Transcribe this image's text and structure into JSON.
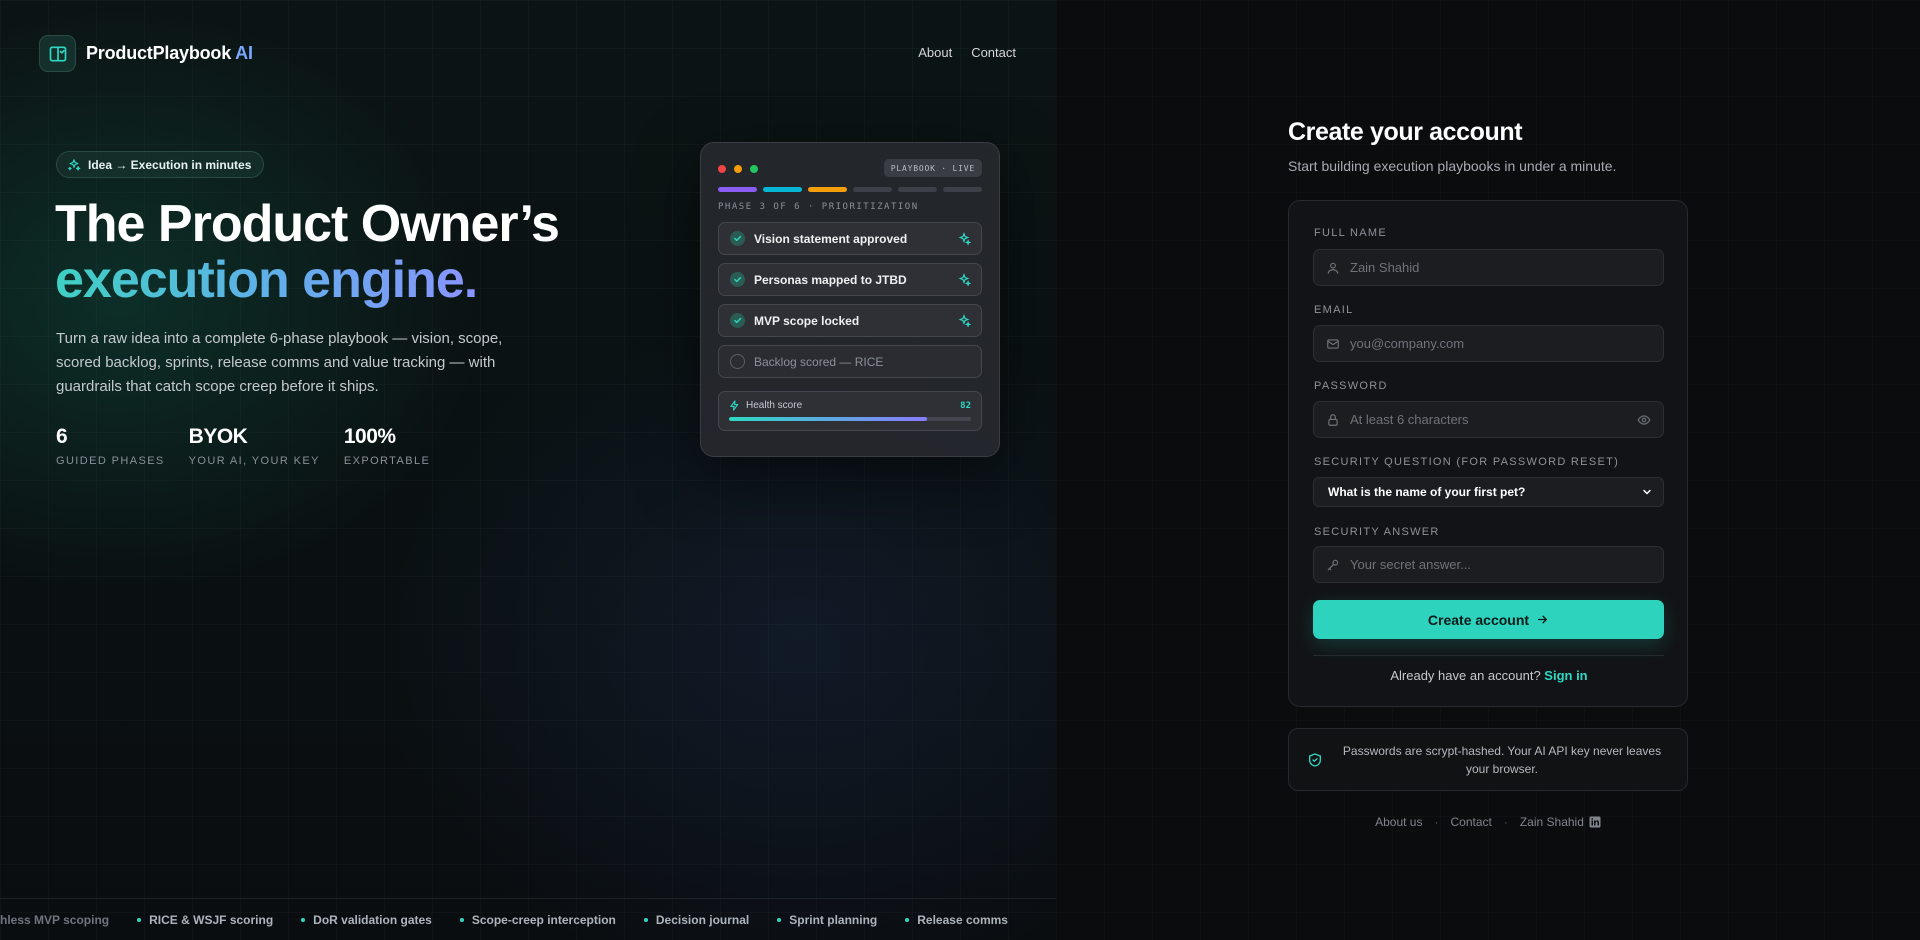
{
  "brand": {
    "name": "ProductPlaybook",
    "suffix": "AI"
  },
  "nav": {
    "about": "About",
    "contact": "Contact"
  },
  "hero": {
    "pill": "Idea → Execution in minutes",
    "title_line1": "The Product Owner’s",
    "title_line2": "execution engine.",
    "description": "Turn a raw idea into a complete 6-phase playbook — vision, scope, scored backlog, sprints, release comms and value tracking — with guardrails that catch scope creep before it ships.",
    "stats": [
      {
        "value": "6",
        "label": "GUIDED PHASES"
      },
      {
        "value": "BYOK",
        "label": "YOUR AI, YOUR KEY"
      },
      {
        "value": "100%",
        "label": "EXPORTABLE"
      }
    ]
  },
  "playbook_card": {
    "badge": "PLAYBOOK · LIVE",
    "phase": "PHASE 3 OF 6 · PRIORITIZATION",
    "phase_colors": [
      "#8b5cf6",
      "#06b6d4",
      "#f59e0b",
      "#3d4048",
      "#3d4048",
      "#3d4048"
    ],
    "tasks": [
      {
        "label": "Vision statement approved",
        "done": true
      },
      {
        "label": "Personas mapped to JTBD",
        "done": true
      },
      {
        "label": "MVP scope locked",
        "done": true
      },
      {
        "label": "Backlog scored — RICE",
        "done": false
      }
    ],
    "health": {
      "label": "Health score",
      "score": "82",
      "progress_pct": 82
    }
  },
  "ticker": {
    "items": [
      "Ruthless MVP scoping",
      "RICE & WSJF scoring",
      "DoR validation gates",
      "Scope-creep interception",
      "Decision journal",
      "Sprint planning",
      "Release comms"
    ]
  },
  "signup": {
    "title": "Create your account",
    "subtitle": "Start building execution playbooks in under a minute.",
    "full_name": {
      "label": "FULL NAME",
      "placeholder": "Zain Shahid"
    },
    "email": {
      "label": "EMAIL",
      "placeholder": "you@company.com"
    },
    "password": {
      "label": "PASSWORD",
      "placeholder": "At least 6 characters"
    },
    "security_question": {
      "label": "SECURITY QUESTION (FOR PASSWORD RESET)",
      "selected": "What is the name of your first pet?"
    },
    "security_answer": {
      "label": "SECURITY ANSWER",
      "placeholder": "Your secret answer..."
    },
    "submit": "Create account",
    "signin_prompt": "Already have an account?",
    "signin_link": "Sign in"
  },
  "notice": "Passwords are scrypt-hashed. Your AI API key never leaves your browser.",
  "footer": {
    "about": "About us",
    "contact": "Contact",
    "author": "Zain Shahid",
    "separator": "·"
  },
  "colors": {
    "accent": "#2ed3be",
    "brand_ai": "#7aa7ff"
  }
}
